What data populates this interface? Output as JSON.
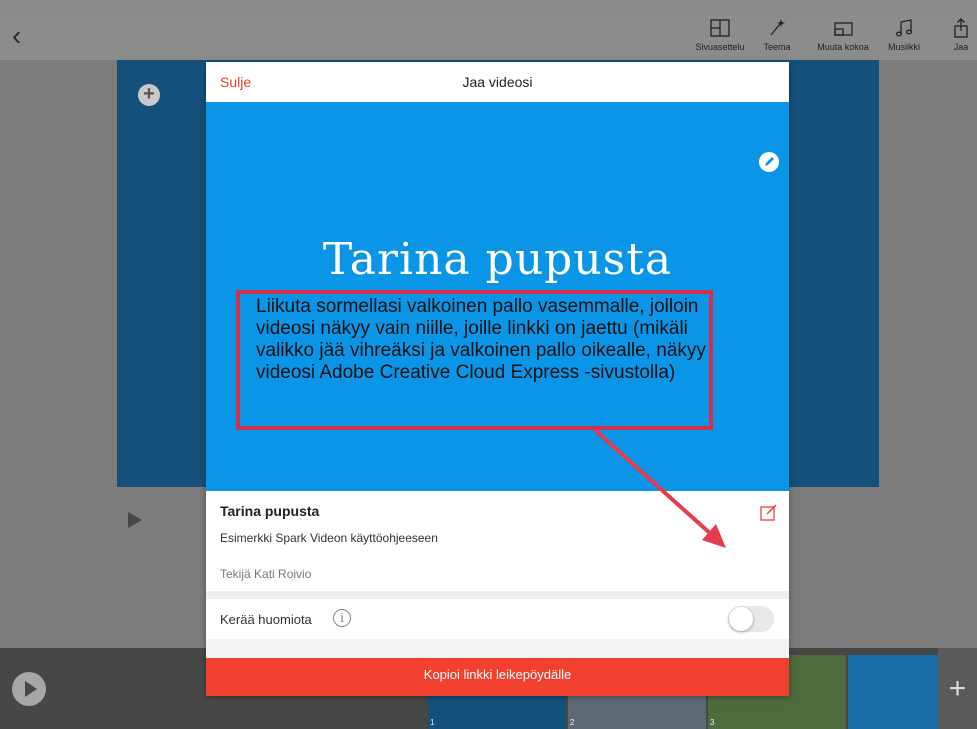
{
  "toolbar": {
    "layout_label": "Sivuasettelu",
    "theme_label": "Teema",
    "resize_label": "Muuta kokoa",
    "music_label": "Musiikki",
    "share_label": "Jaa"
  },
  "modal": {
    "close_label": "Sulje",
    "title": "Jaa videosi",
    "preview_title": "Tarina pupusta",
    "video_title": "Tarina pupusta",
    "video_description": "Esimerkki Spark Videon käyttöohjeeseen",
    "author": "Tekijä Kati Roivio",
    "toggle_label": "Kerää huomiota",
    "toggle_on": false,
    "copy_button": "Kopioi linkki leikepöydälle"
  },
  "callout": {
    "text": "Liikuta sormellasi valkoinen pallo vasemmalle, jolloin videosi näkyy vain niille, joille linkki on jaettu (mikäli valikko jää vihreäksi ja valkoinen pallo oikealle, näkyy videosi Adobe Creative Cloud Express -sivustolla)"
  },
  "thumbnails": [
    {
      "number": "1"
    },
    {
      "number": "2"
    },
    {
      "number": "3"
    }
  ],
  "colors": {
    "accent": "#f1412e",
    "preview_bg": "#0b95e6",
    "callout_border": "#d0304d"
  }
}
